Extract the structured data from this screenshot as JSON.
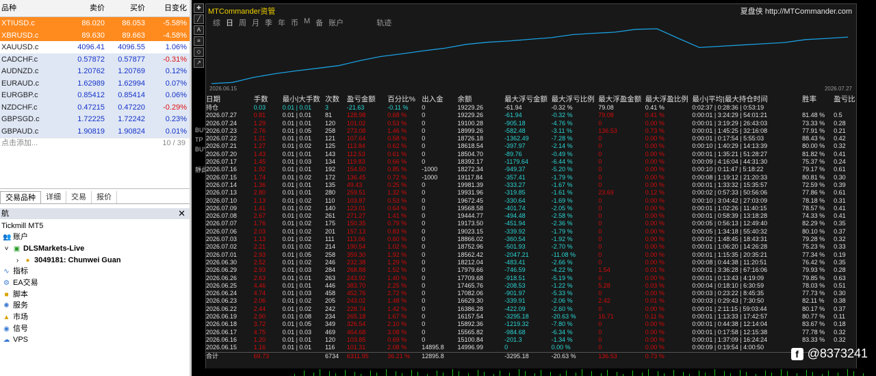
{
  "market_watch": {
    "headers": {
      "symbol": "品种",
      "bid": "卖价",
      "ask": "买价",
      "change": "日变化"
    },
    "rows": [
      {
        "symbol": "XTIUSD.c",
        "bid": "86.020",
        "ask": "86.053",
        "change": "-5.58%",
        "style": "hl"
      },
      {
        "symbol": "XBRUSD.c",
        "bid": "89.630",
        "ask": "89.663",
        "change": "-4.58%",
        "style": "hl"
      },
      {
        "symbol": "XAUUSD.c",
        "bid": "4096.41",
        "ask": "4096.55",
        "change": "1.06%",
        "style": "wh"
      },
      {
        "symbol": "CADCHF.c",
        "bid": "0.57872",
        "ask": "0.57877",
        "change": "-0.31%",
        "style": "bl"
      },
      {
        "symbol": "AUDNZD.c",
        "bid": "1.20762",
        "ask": "1.20769",
        "change": "0.12%",
        "style": "bl"
      },
      {
        "symbol": "EURAUD.c",
        "bid": "1.62989",
        "ask": "1.62994",
        "change": "0.07%",
        "style": "bl"
      },
      {
        "symbol": "EURGBP.c",
        "bid": "0.85412",
        "ask": "0.85414",
        "change": "0.06%",
        "style": "bl"
      },
      {
        "symbol": "NZDCHF.c",
        "bid": "0.47215",
        "ask": "0.47220",
        "change": "-0.29%",
        "style": "bl"
      },
      {
        "symbol": "GBPSGD.c",
        "bid": "1.72225",
        "ask": "1.72242",
        "change": "0.23%",
        "style": "bl"
      },
      {
        "symbol": "GBPAUD.c",
        "bid": "1.90819",
        "ask": "1.90824",
        "change": "0.01%",
        "style": "bl"
      }
    ],
    "add_label": "点击添加...",
    "count": "10 / 39",
    "tabs": [
      "交易品种",
      "详细",
      "交易",
      "报价"
    ]
  },
  "navigator": {
    "title": "航",
    "broker": "Tickmill MT5",
    "items": {
      "accounts": "账户",
      "server": "DLSMarkets-Live",
      "account": "3049181: Chunwei Guan",
      "indicators": "指标",
      "ea": "EA交易",
      "scripts": "脚本",
      "services": "服务",
      "market": "市场",
      "signals": "信号",
      "vps": "VPS"
    }
  },
  "side_labels": [
    "BUY",
    "TP",
    "BUY",
    "靜此"
  ],
  "window": {
    "title": "MTCommander资管",
    "right_text": "夏盘侠 http://MTCommander.com",
    "tabs": [
      "综",
      "日",
      "周",
      "月",
      "季",
      "年",
      "币",
      "M",
      "备",
      "账户",
      "轨迹"
    ],
    "active_tab": "日",
    "chart_start": "2026.06.15",
    "chart_end": "2026.07.27",
    "columns": [
      "日期",
      "手数",
      "最小|大手数",
      "次数",
      "盈亏金额",
      "百分比%",
      "出入金",
      "余额",
      "最大浮亏金额",
      "最大浮亏比例",
      "最大浮盈金额",
      "最大浮盈比例",
      "最小|平均|最大持仓时间",
      "胜率",
      "盈亏比"
    ],
    "position_row": [
      "持仓",
      "0.03",
      "0.01 | 0.01",
      "3",
      "-21.63",
      "-0.11 %",
      "0",
      "19229.26",
      "-61.94",
      "-0.32 %",
      "79.08",
      "0.41 %",
      "0:02:37 | 0:28:36 | 0:53:19",
      "",
      ""
    ],
    "rows": [
      [
        "2026.07.27",
        "0.81",
        "0.01 | 0.01",
        "81",
        "128.98",
        "0.68 %",
        "0",
        "19229.26",
        "-61.94",
        "-0.32 %",
        "79.08",
        "0.41 %",
        "0:00:01 | 3:24:29 | 54:01:21",
        "81.48 %",
        "0.5"
      ],
      [
        "2026.07.24",
        "1.29",
        "0.01 | 0.01",
        "120",
        "101.02",
        "0.53 %",
        "0",
        "19100.28",
        "-905.18",
        "-4.76 %",
        "0",
        "0.00 %",
        "0:00:01 | 3:19:29 | 26:43:03",
        "73.33 %",
        "0.28"
      ],
      [
        "2026.07.23",
        "2.76",
        "0.01 | 0.05",
        "258",
        "273.08",
        "1.46 %",
        "0",
        "18999.26",
        "-582.48",
        "-3.11 %",
        "136.53",
        "0.73 %",
        "0:00:01 | 1:45:25 | 32:16:08",
        "77.91 %",
        "0.21"
      ],
      [
        "2026.07.22",
        "1.21",
        "0.01 | 0.01",
        "121",
        "107.64",
        "0.58 %",
        "0",
        "18726.18",
        "-1362.49",
        "-7.28 %",
        "0",
        "0.00 %",
        "0:00:01 | 0:17:54 | 5:55:03",
        "88.43 %",
        "0.42"
      ],
      [
        "2026.07.21",
        "1.27",
        "0.01 | 0.02",
        "125",
        "113.84",
        "0.62 %",
        "0",
        "18618.54",
        "-397.97",
        "-2.14 %",
        "0",
        "0.00 %",
        "0:00:10 | 1:40:29 | 14:13:39",
        "80.00 %",
        "0.32"
      ],
      [
        "2026.07.20",
        "1.43",
        "0.01 | 0.01",
        "143",
        "112.53",
        "0.61 %",
        "0",
        "18504.70",
        "-89.76",
        "-0.49 %",
        "0",
        "0.00 %",
        "0:00:01 | 1:35:21 | 51:28:27",
        "81.82 %",
        "0.41"
      ],
      [
        "2026.07.17",
        "1.45",
        "0.01 | 0.03",
        "134",
        "119.83",
        "0.66 %",
        "0",
        "18392.17",
        "-1179.64",
        "-6.44 %",
        "0",
        "0.00 %",
        "0:00:09 | 4:16:04 | 44:31:30",
        "75.37 %",
        "0.24"
      ],
      [
        "2026.07.16",
        "1.92",
        "0.01 | 0.01",
        "192",
        "154.50",
        "0.85 %",
        "-1000",
        "18272.34",
        "-949.37",
        "-5.20 %",
        "0",
        "0.00 %",
        "0:00:10 | 0:11:47 | 5:18:22",
        "79.17 %",
        "0.61"
      ],
      [
        "2026.07.15",
        "1.74",
        "0.01 | 0.02",
        "172",
        "136.45",
        "0.72 %",
        "-1000",
        "19117.84",
        "-357.41",
        "-1.79 %",
        "0",
        "0.00 %",
        "0:00:08 | 1:19:12 | 21:20:33",
        "80.81 %",
        "0.30"
      ],
      [
        "2026.07.14",
        "1.36",
        "0.01 | 0.01",
        "135",
        "49.43",
        "0.25 %",
        "0",
        "19981.39",
        "-333.27",
        "-1.67 %",
        "0",
        "0.00 %",
        "0:00:01 | 1:33:32 | 15:35:57",
        "72.59 %",
        "0.39"
      ],
      [
        "2026.07.13",
        "2.80",
        "0.01 | 0.01",
        "280",
        "259.51",
        "1.32 %",
        "0",
        "19931.96",
        "-319.85",
        "-1.61 %",
        "23.69",
        "0.12 %",
        "0:00:02 | 0:57:33 | 50:56:06",
        "77.86 %",
        "0.61"
      ],
      [
        "2026.07.10",
        "1.13",
        "0.01 | 0.02",
        "110",
        "103.87",
        "0.53 %",
        "0",
        "19672.45",
        "-330.64",
        "-1.69 %",
        "0",
        "0.00 %",
        "0:00:10 | 3:04:42 | 27:03:09",
        "78.18 %",
        "0.31"
      ],
      [
        "2026.07.09",
        "1.41",
        "0.01 | 0.02",
        "140",
        "123.01",
        "0.64 %",
        "0",
        "19568.58",
        "-401.74",
        "-2.05 %",
        "0",
        "0.00 %",
        "0:00:01 | 1:02:26 | 11:40:15",
        "78.57 %",
        "0.41"
      ],
      [
        "2026.07.08",
        "2.67",
        "0.01 | 0.02",
        "261",
        "271.27",
        "1.41 %",
        "0",
        "19444.77",
        "-494.48",
        "-2.58 %",
        "0",
        "0.00 %",
        "0:00:01 | 0:58:39 | 13:18:28",
        "74.33 %",
        "0.41"
      ],
      [
        "2026.07.07",
        "1.76",
        "0.01 | 0.02",
        "175",
        "150.35",
        "0.79 %",
        "0",
        "19173.50",
        "-451.94",
        "-2.36 %",
        "0",
        "0.00 %",
        "0:00:05 | 0:56:13 | 12:49:40",
        "82.29 %",
        "0.35"
      ],
      [
        "2026.07.06",
        "2.03",
        "0.01 | 0.02",
        "201",
        "157.13",
        "0.83 %",
        "0",
        "19023.15",
        "-339.92",
        "-1.79 %",
        "0",
        "0.00 %",
        "0:00:05 | 1:34:18 | 55:40:32",
        "80.10 %",
        "0.37"
      ],
      [
        "2026.07.03",
        "1.13",
        "0.01 | 0.02",
        "111",
        "113.06",
        "0.60 %",
        "0",
        "18866.02",
        "-360.54",
        "-1.92 %",
        "0",
        "0.00 %",
        "0:00:02 | 1:48:45 | 18:43:31",
        "79.28 %",
        "0.32"
      ],
      [
        "2026.07.02",
        "2.21",
        "0.01 | 0.02",
        "214",
        "190.54",
        "1.02 %",
        "0",
        "18752.96",
        "-501.93",
        "-2.70 %",
        "0",
        "0.00 %",
        "0:00:01 | 1:06:20 | 14:26:28",
        "75.23 %",
        "0.33"
      ],
      [
        "2026.07.01",
        "2.93",
        "0.01 | 0.05",
        "258",
        "359.30",
        "1.92 %",
        "0",
        "18562.42",
        "-2047.21",
        "-11.08 %",
        "0",
        "0.00 %",
        "0:00:01 | 1:15:35 | 20:35:21",
        "77.34 %",
        "0.19"
      ],
      [
        "2026.06.30",
        "2.52",
        "0.01 | 0.02",
        "246",
        "232.38",
        "1.29 %",
        "0",
        "18212.04",
        "-483.41",
        "-2.66 %",
        "0",
        "0.00 %",
        "0:00:08 | 0:44:38 | 11:20:51",
        "76.42 %",
        "0.35"
      ],
      [
        "2026.06.29",
        "2.93",
        "0.01 | 0.03",
        "284",
        "268.88",
        "1.52 %",
        "0",
        "17979.66",
        "-746.59",
        "-4.22 %",
        "1.54",
        "0.01 %",
        "0:00:01 | 3:36:28 | 67:16:06",
        "79.93 %",
        "0.28"
      ],
      [
        "2026.06.26",
        "2.63",
        "0.01 | 0.01",
        "263",
        "243.92",
        "1.40 %",
        "0",
        "17709.68",
        "-918.51",
        "-5.19 %",
        "0",
        "0.00 %",
        "0:00:01 | 0:13:43 | 4:19:09",
        "79.85 %",
        "0.63"
      ],
      [
        "2026.06.25",
        "4.46",
        "0.01 | 0.01",
        "446",
        "383.70",
        "2.25 %",
        "0",
        "17465.76",
        "-208.53",
        "-1.22 %",
        "5.28",
        "0.03 %",
        "0:00:04 | 0:18:10 | 6:30:59",
        "78.03 %",
        "0.51"
      ],
      [
        "2026.06.24",
        "4.74",
        "0.01 | 0.03",
        "458",
        "452.76",
        "2.72 %",
        "0",
        "17082.06",
        "-901.97",
        "-5.33 %",
        "0",
        "0.00 %",
        "0:00:03 | 0:23:22 | 8:45:35",
        "77.73 %",
        "0.30"
      ],
      [
        "2026.06.23",
        "2.06",
        "0.01 | 0.02",
        "205",
        "243.02",
        "1.48 %",
        "0",
        "16629.30",
        "-339.91",
        "-2.06 %",
        "2.42",
        "0.01 %",
        "0:00:03 | 0:29:43 | 7:30:50",
        "82.11 %",
        "0.38"
      ],
      [
        "2026.06.22",
        "2.44",
        "0.01 | 0.02",
        "242",
        "228.74",
        "1.42 %",
        "0",
        "16386.28",
        "-422.09",
        "-2.60 %",
        "0",
        "0.00 %",
        "0:00:01 | 2:11:15 | 59:03:44",
        "80.17 %",
        "0.37"
      ],
      [
        "2026.06.19",
        "2.90",
        "0.01 | 0.08",
        "234",
        "265.18",
        "1.67 %",
        "0",
        "16157.54",
        "-3295.18",
        "-20.63 %",
        "16.71",
        "0.11 %",
        "0:00:01 | 1:13:33 | 17:42:57",
        "80.77 %",
        "0.11"
      ],
      [
        "2026.06.18",
        "3.72",
        "0.01 | 0.05",
        "349",
        "326.54",
        "2.10 %",
        "0",
        "15892.36",
        "-1219.32",
        "-7.80 %",
        "0",
        "0.00 %",
        "0:00:01 | 0:44:38 | 12:14:04",
        "83.67 %",
        "0.18"
      ],
      [
        "2026.06.17",
        "4.75",
        "0.01 | 0.03",
        "469",
        "464.68",
        "3.08 %",
        "0",
        "15565.82",
        "-984.68",
        "-6.34 %",
        "0",
        "0.00 %",
        "0:00:01 | 0:17:58 | 12:15:38",
        "77.78 %",
        "0.32"
      ],
      [
        "2026.06.16",
        "1.20",
        "0.01 | 0.01",
        "120",
        "103.85",
        "0.69 %",
        "0",
        "15100.84",
        "-201.3",
        "-1.34 %",
        "0",
        "0.00 %",
        "0:00:01 | 1:37:09 | 16:24:24",
        "83.33 %",
        "0.32"
      ],
      [
        "2026.06.15",
        "1.16",
        "0.01 | 0.01",
        "116",
        "101.31",
        "2.08 %",
        "14895.8",
        "14996.99",
        "0",
        "0.00 %",
        "0",
        "0.00 %",
        "0:00:09 | 0:19:54 | 4:00:50",
        "",
        ""
      ]
    ],
    "total_row": [
      "合计",
      "69.73",
      "",
      "6734",
      "6311.95",
      "36.21 %",
      "12895.8",
      "",
      "-3295.18",
      "-20.63 %",
      "136.53",
      "0.73 %",
      "",
      "",
      ""
    ]
  },
  "watermark": "@8373241",
  "colors": {
    "highlight": "#ff8a1e",
    "selected_row": "#dfe7f5",
    "positive": "#1432c8",
    "negative": "#e01010",
    "curve": "#1a9fe0",
    "profit_text": "#d40a0a",
    "float_text": "#2bd6d6"
  }
}
